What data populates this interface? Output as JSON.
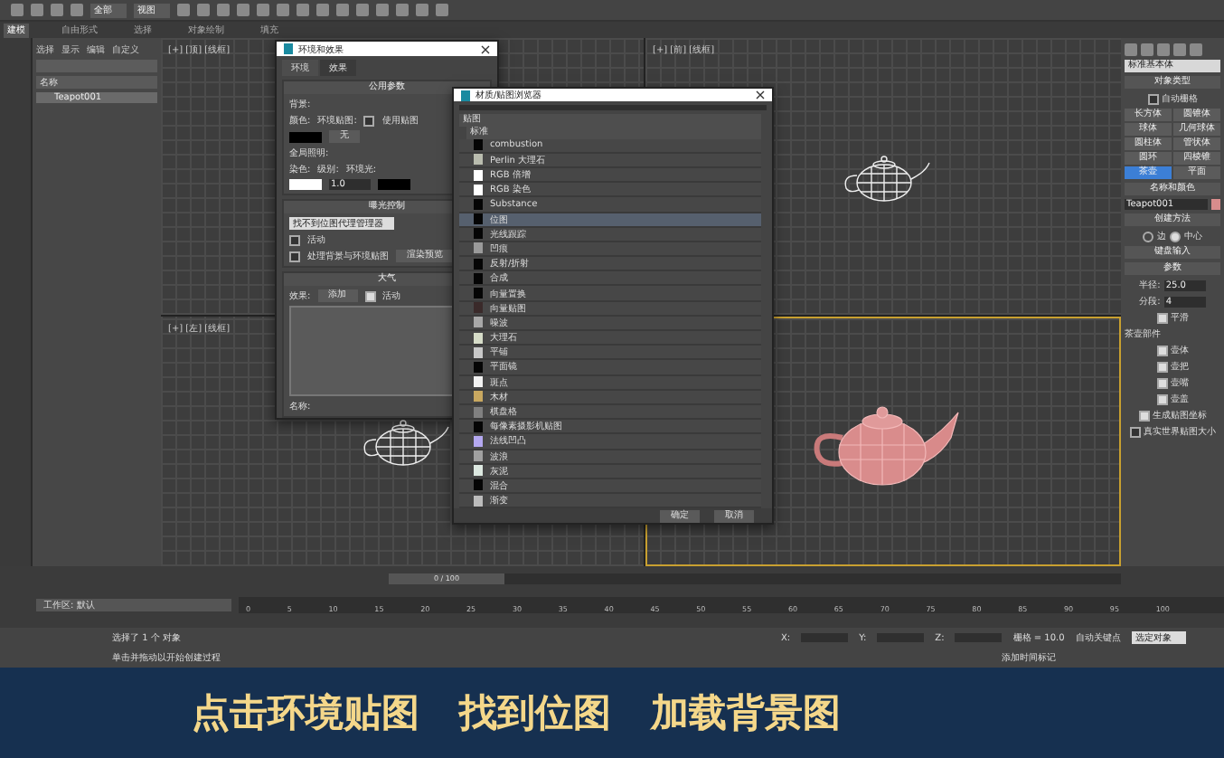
{
  "toolbar": {
    "dropdowns": [
      "全部",
      "视图"
    ]
  },
  "ribbon_tabs": [
    {
      "label": "建模",
      "selected": true
    },
    {
      "label": "自由形式",
      "selected": false
    },
    {
      "label": "选择",
      "selected": false
    },
    {
      "label": "对象绘制",
      "selected": false
    },
    {
      "label": "填充",
      "selected": false
    }
  ],
  "explorer": {
    "tabs": [
      "选择",
      "显示",
      "编辑",
      "自定义"
    ],
    "column": "名称",
    "items": [
      {
        "label": "Teapot001",
        "selected": true
      }
    ]
  },
  "viewports": [
    {
      "label": "[+] [顶] [线框]",
      "kind": "empty",
      "active": false
    },
    {
      "label": "[+] [前] [线框]",
      "kind": "wire",
      "active": false
    },
    {
      "label": "[+] [左] [线框]",
      "kind": "wire",
      "active": false
    },
    {
      "kind": "shaded",
      "active": true
    }
  ],
  "environment_dialog": {
    "title": "环境和效果",
    "tabs": [
      {
        "label": "环境",
        "selected": true
      },
      {
        "label": "效果",
        "selected": false
      }
    ],
    "common": {
      "title": "公用参数",
      "background": "背景:",
      "color_label": "颜色:",
      "env_map": "环境贴图:",
      "use_map": {
        "label": "使用贴图",
        "checked": false
      },
      "none_button": "无",
      "gi": "全局照明:",
      "tint": "染色:",
      "level_label": "级别:",
      "level_value": "1.0",
      "ambient": "环境光:"
    },
    "exposure": {
      "title": "曝光控制",
      "select": "找不到位图代理管理器",
      "active": {
        "label": "活动",
        "checked": false
      },
      "process_bg": {
        "label": "处理背景与环境贴图",
        "checked": false
      },
      "render_preview": "渲染预览"
    },
    "atmosphere": {
      "title": "大气",
      "effects": "效果:",
      "name": "名称:",
      "add": "添加",
      "active": {
        "label": "活动",
        "checked": true
      }
    }
  },
  "map_browser": {
    "title": "材质/贴图浏览器",
    "group": "贴图",
    "subgroup": "标准",
    "items": [
      {
        "label": "combustion",
        "color": "#050505",
        "hover": false
      },
      {
        "label": "Perlin 大理石",
        "color": "#b9bcae",
        "hover": false
      },
      {
        "label": "RGB 倍增",
        "color": "#ffffff",
        "hover": false
      },
      {
        "label": "RGB 染色",
        "color": "#ffffff",
        "hover": false
      },
      {
        "label": "Substance",
        "color": "#050505",
        "hover": false
      },
      {
        "label": "位图",
        "color": "#050505",
        "hover": true
      },
      {
        "label": "光线跟踪",
        "color": "#050505",
        "hover": false
      },
      {
        "label": "凹痕",
        "color": "#9a9a9a",
        "hover": false
      },
      {
        "label": "反射/折射",
        "color": "#050505",
        "hover": false
      },
      {
        "label": "合成",
        "color": "#050505",
        "hover": false
      },
      {
        "label": "向量置换",
        "color": "#050505",
        "hover": false
      },
      {
        "label": "向量贴图",
        "color": "#3a2a2a",
        "hover": false
      },
      {
        "label": "噪波",
        "color": "#a8a8a8",
        "hover": false
      },
      {
        "label": "大理石",
        "color": "#d6dcc8",
        "hover": false
      },
      {
        "label": "平铺",
        "color": "#c8c8c8",
        "hover": false
      },
      {
        "label": "平面镜",
        "color": "#050505",
        "hover": false
      },
      {
        "label": "斑点",
        "color": "#f2f2f2",
        "hover": false
      },
      {
        "label": "木材",
        "color": "#c9a860",
        "hover": false
      },
      {
        "label": "棋盘格",
        "color": "#808080",
        "hover": false
      },
      {
        "label": "每像素摄影机贴图",
        "color": "#050505",
        "hover": false
      },
      {
        "label": "法线凹凸",
        "color": "#b4a8f0",
        "hover": false
      },
      {
        "label": "波浪",
        "color": "#a0a0a0",
        "hover": false
      },
      {
        "label": "灰泥",
        "color": "#dce8e0",
        "hover": false
      },
      {
        "label": "混合",
        "color": "#050505",
        "hover": false
      },
      {
        "label": "渐变",
        "color": "#bcbcbc",
        "hover": false
      }
    ],
    "ok": "确定",
    "cancel": "取消"
  },
  "command_panel": {
    "category": "标准基本体",
    "object_type": "对象类型",
    "autogrid": {
      "label": "自动栅格",
      "checked": false
    },
    "primitives": [
      {
        "label": "长方体",
        "selected": false
      },
      {
        "label": "圆锥体",
        "selected": false
      },
      {
        "label": "球体",
        "selected": false
      },
      {
        "label": "几何球体",
        "selected": false
      },
      {
        "label": "圆柱体",
        "selected": false
      },
      {
        "label": "管状体",
        "selected": false
      },
      {
        "label": "圆环",
        "selected": false
      },
      {
        "label": "四棱锥",
        "selected": false
      },
      {
        "label": "茶壶",
        "selected": true
      },
      {
        "label": "平面",
        "selected": false
      }
    ],
    "name_color": "名称和颜色",
    "name": "Teapot001",
    "creation": "创建方法",
    "methods": [
      {
        "label": "边",
        "selected": false
      },
      {
        "label": "中心",
        "selected": true
      }
    ],
    "keyboard": "键盘输入",
    "params": "参数",
    "radius_label": "半径:",
    "radius": "25.0",
    "segments_label": "分段:",
    "segments": "4",
    "smooth": {
      "label": "平滑",
      "checked": true
    },
    "parts_title": "茶壶部件",
    "parts": [
      {
        "label": "壶体",
        "checked": true
      },
      {
        "label": "壶把",
        "checked": true
      },
      {
        "label": "壶嘴",
        "checked": true
      },
      {
        "label": "壶盖",
        "checked": true
      }
    ],
    "gen_uv": {
      "label": "生成贴图坐标",
      "checked": true
    },
    "real_world": {
      "label": "真实世界贴图大小",
      "checked": false
    }
  },
  "timeline": {
    "slider": "0 / 100",
    "level": 0,
    "ticks": [
      "0",
      "5",
      "10",
      "15",
      "20",
      "25",
      "30",
      "35",
      "40",
      "45",
      "50",
      "55",
      "60",
      "65",
      "70",
      "75",
      "80",
      "85",
      "90",
      "95",
      "100"
    ],
    "workspace": "工作区: 默认"
  },
  "status": {
    "selection": "选择了 1 个 对象",
    "prompt": "单击并拖动以开始创建过程",
    "x": "X:",
    "y": "Y:",
    "z": "Z:",
    "grid": "栅格 = 10.0",
    "autokey": "自动关键点",
    "key_filter": "选定对象",
    "add_tag": "添加时间标记"
  },
  "subtitle": [
    "点击环境贴图",
    "找到位图",
    "加载背景图"
  ]
}
